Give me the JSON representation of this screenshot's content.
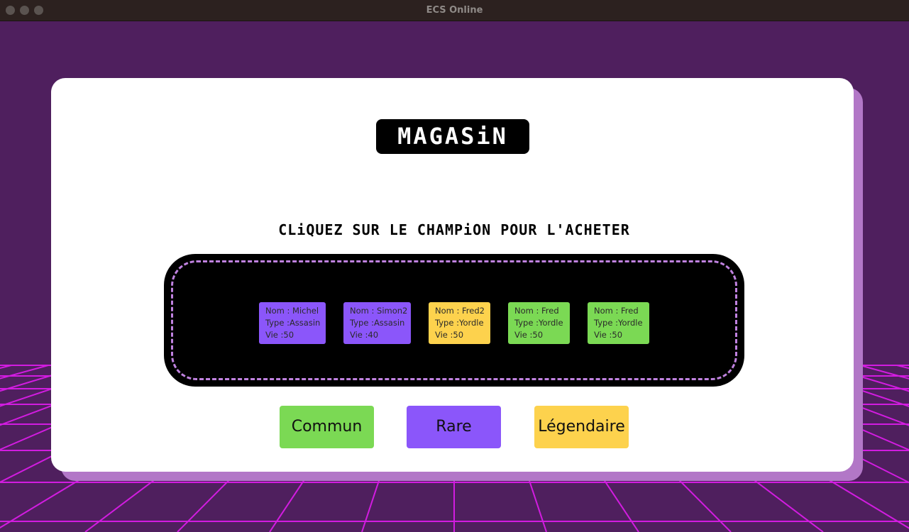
{
  "window": {
    "title": "ECS Online"
  },
  "shop": {
    "title": "MAGASiN",
    "instruction": "CLiQUEZ SUR LE CHAMPiON POUR L'ACHETER",
    "champions": [
      {
        "nom": "Nom : Michel",
        "type": "Type :Assasin",
        "vie": "Vie :50",
        "rarity": "rare",
        "color": "#8b56fa"
      },
      {
        "nom": "Nom : Simon2",
        "type": "Type :Assasin",
        "vie": "Vie :40",
        "rarity": "rare",
        "color": "#8b56fa"
      },
      {
        "nom": "Nom : Fred2",
        "type": "Type :Yordle",
        "vie": "Vie :50",
        "rarity": "legendary",
        "color": "#fdd24d"
      },
      {
        "nom": "Nom : Fred",
        "type": "Type :Yordle",
        "vie": "Vie :50",
        "rarity": "common",
        "color": "#7bd954"
      },
      {
        "nom": "Nom : Fred",
        "type": "Type :Yordle",
        "vie": "Vie :50",
        "rarity": "common",
        "color": "#7bd954"
      }
    ],
    "filters": {
      "common_label": "Commun",
      "rare_label": "Rare",
      "legendary_label": "Légendaire"
    }
  },
  "colors": {
    "background": "#4f1f5e",
    "grid": "#d21ce0",
    "common": "#7bd954",
    "rare": "#8b56fa",
    "legendary": "#fdd24d",
    "dashed_border": "#c082e0"
  }
}
